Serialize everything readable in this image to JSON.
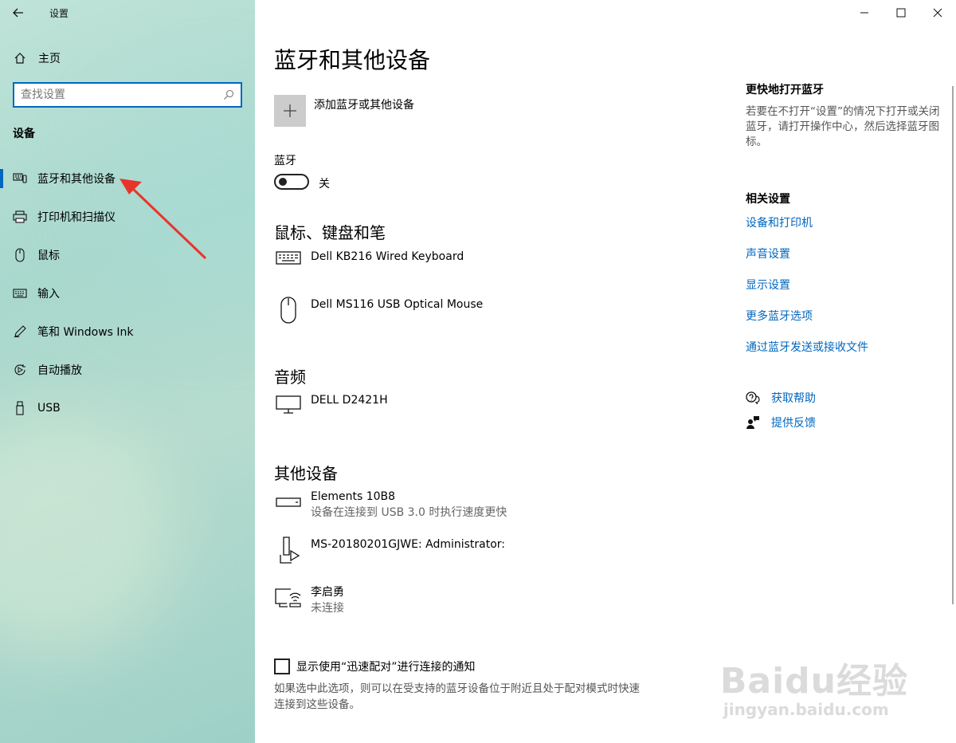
{
  "app": {
    "title": "设置"
  },
  "sidebar": {
    "home_label": "主页",
    "search_placeholder": "查找设置",
    "section": "设备",
    "items": [
      {
        "label": "蓝牙和其他设备",
        "icon": "bluetooth-devices-icon",
        "active": true
      },
      {
        "label": "打印机和扫描仪",
        "icon": "printer-icon"
      },
      {
        "label": "鼠标",
        "icon": "mouse-icon"
      },
      {
        "label": "输入",
        "icon": "keyboard-icon"
      },
      {
        "label": "笔和 Windows Ink",
        "icon": "pen-icon"
      },
      {
        "label": "自动播放",
        "icon": "autoplay-icon"
      },
      {
        "label": "USB",
        "icon": "usb-icon"
      }
    ]
  },
  "main": {
    "title": "蓝牙和其他设备",
    "add_device_label": "添加蓝牙或其他设备",
    "bluetooth": {
      "label": "蓝牙",
      "state": "关"
    },
    "groups": {
      "input": {
        "title": "鼠标、键盘和笔",
        "devices": [
          {
            "name": "Dell KB216 Wired Keyboard",
            "icon": "keyboard-icon"
          },
          {
            "name": "Dell MS116 USB Optical Mouse",
            "icon": "mouse-icon"
          }
        ]
      },
      "audio": {
        "title": "音频",
        "devices": [
          {
            "name": "DELL D2421H",
            "icon": "monitor-icon"
          }
        ]
      },
      "other": {
        "title": "其他设备",
        "devices": [
          {
            "name": "Elements 10B8",
            "sub": "设备在连接到 USB 3.0 时执行速度更快",
            "icon": "drive-icon"
          },
          {
            "name": "MS-20180201GJWE: Administrator:",
            "icon": "media-device-icon"
          },
          {
            "name": "李启勇",
            "sub": "未连接",
            "icon": "wireless-display-icon"
          }
        ]
      }
    },
    "swift_pair": {
      "label": "显示使用“迅速配对”进行连接的通知",
      "description": "如果选中此选项，则可以在受支持的蓝牙设备位于附近且处于配对模式时快速连接到这些设备。"
    }
  },
  "right": {
    "quick": {
      "title": "更快地打开蓝牙",
      "desc": "若要在不打开“设置”的情况下打开或关闭蓝牙，请打开操作中心，然后选择蓝牙图标。"
    },
    "related": {
      "title": "相关设置",
      "links": [
        "设备和打印机",
        "声音设置",
        "显示设置",
        "更多蓝牙选项",
        "通过蓝牙发送或接收文件"
      ]
    },
    "help": {
      "get_help": "获取帮助",
      "feedback": "提供反馈"
    }
  },
  "watermark": {
    "line1": "Baidu经验",
    "line2": "jingyan.baidu.com"
  },
  "colors": {
    "accent": "#0067c0",
    "arrow": "#e8352a"
  }
}
